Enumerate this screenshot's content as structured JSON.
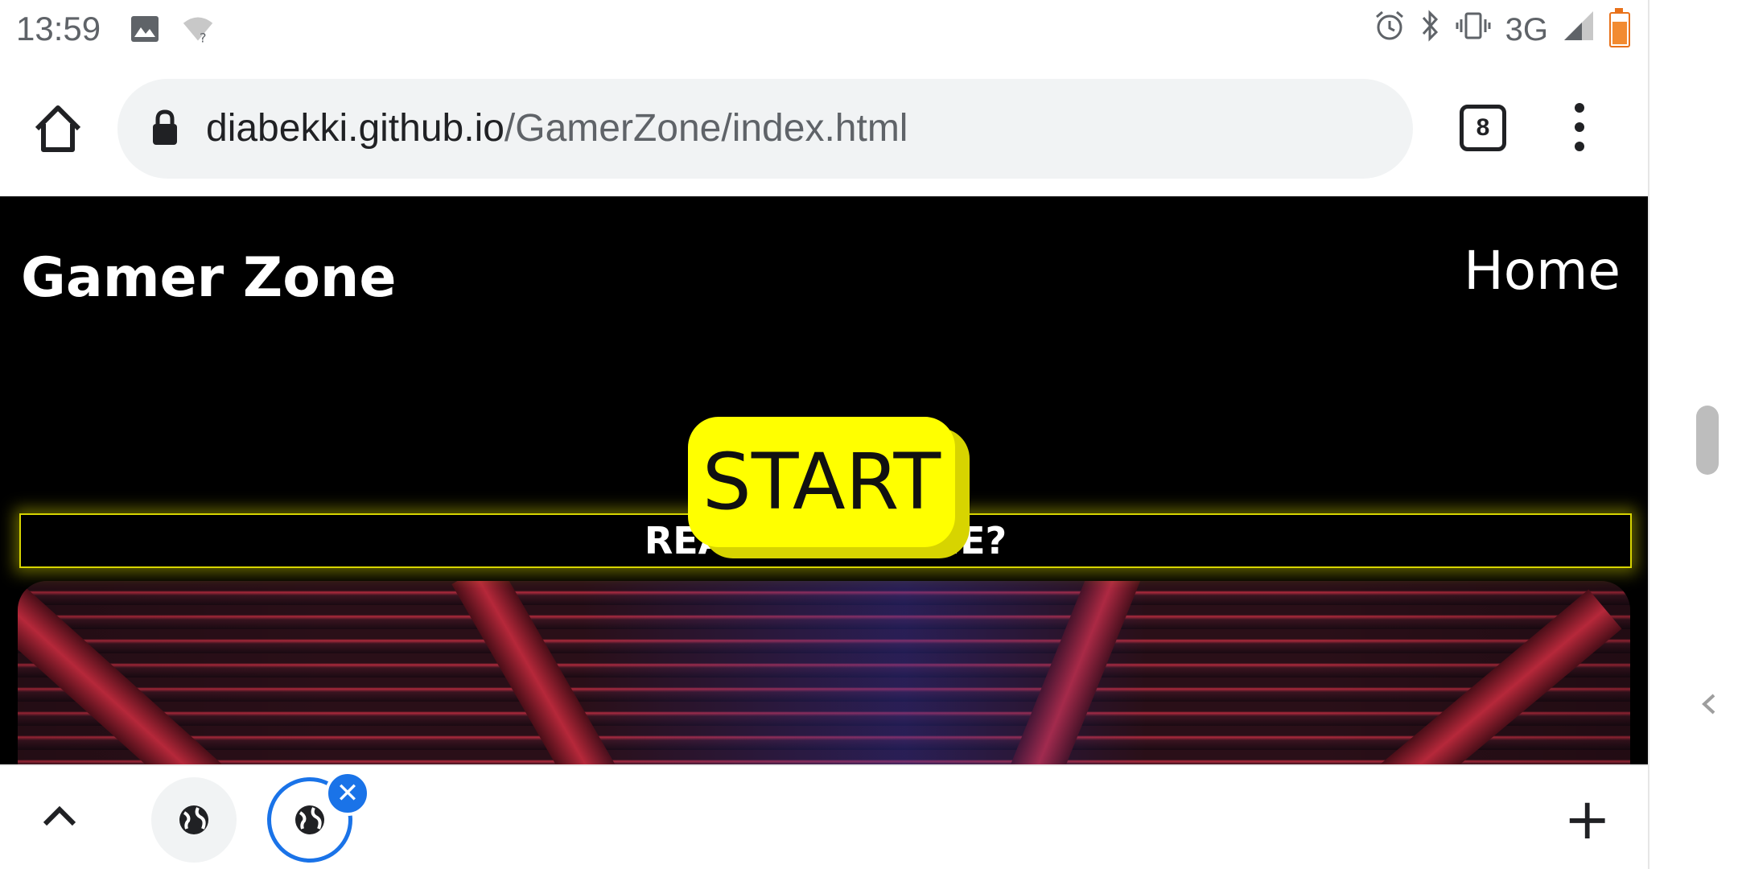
{
  "status_bar": {
    "time": "13:59",
    "network": "3G",
    "icons": [
      "image-icon",
      "wifi-question-icon",
      "alarm-icon",
      "bluetooth-icon",
      "vibrate-icon",
      "signal-icon",
      "battery-icon"
    ]
  },
  "browser": {
    "url_domain": "diabekki.github.io",
    "url_path": "/GamerZone/index.html",
    "tab_count": "8"
  },
  "site": {
    "logo": "Gamer Zone",
    "nav_home": "Home",
    "start_label": "START",
    "banner_text": "READY TO GAME?"
  },
  "tab_strip": {
    "new_tab_label": "+",
    "close_label": "✕"
  },
  "colors": {
    "accent_yellow": "#ffff00",
    "page_bg": "#000000",
    "browser_blue": "#1a73e8"
  }
}
